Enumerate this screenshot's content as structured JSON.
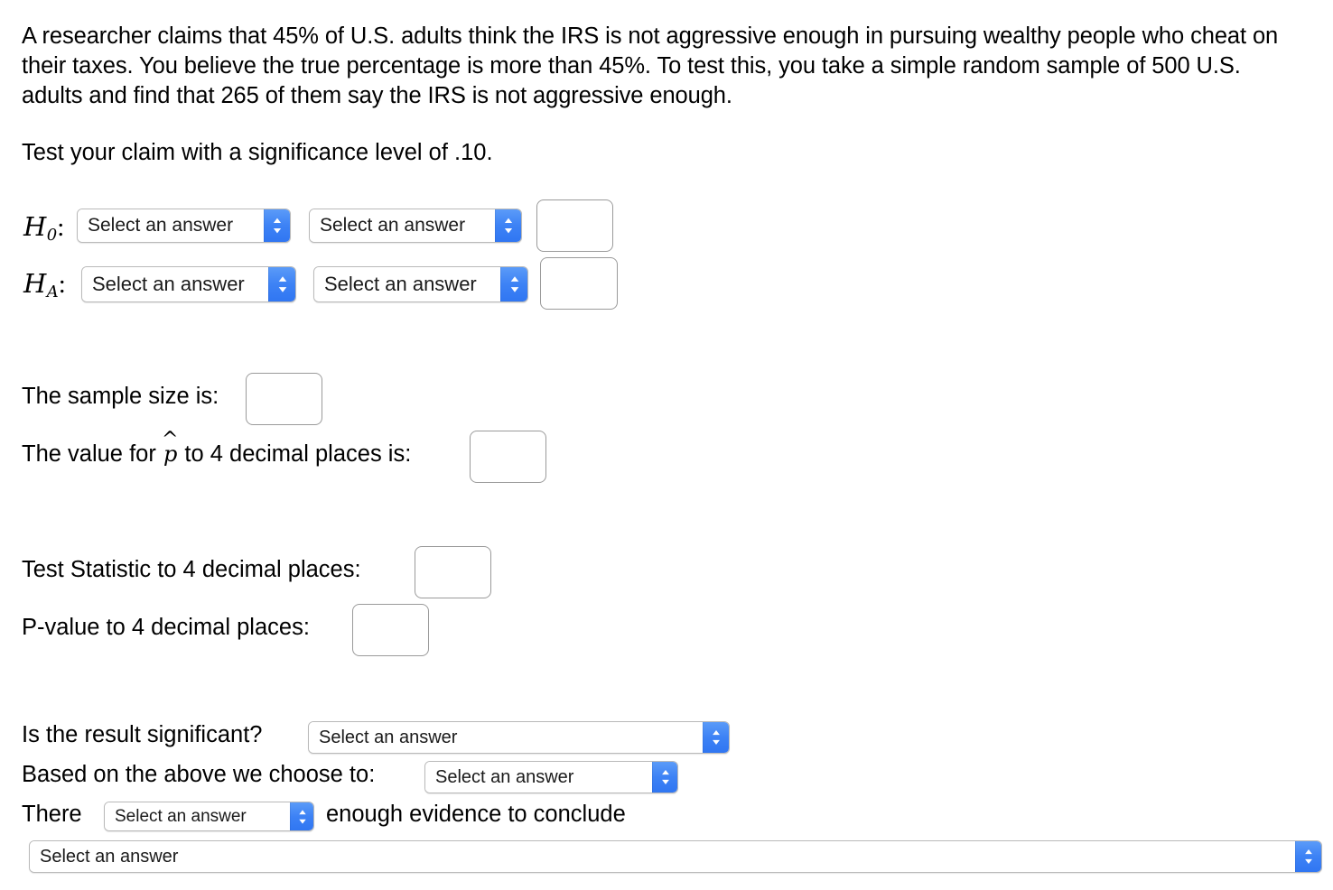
{
  "problem": {
    "statement": "A researcher claims that 45% of U.S. adults think the IRS is not aggressive enough in pursuing wealthy people who cheat on their taxes. You believe the true percentage is more than 45%. To test this, you take a simple random sample of 500 U.S. adults and find that 265 of them say the IRS is not aggressive enough.",
    "significance_instruction": "Test your claim with a significance level of .10."
  },
  "select_placeholder": "Select an answer",
  "hypotheses": {
    "null_label_base": "H",
    "null_label_sub": "0",
    "alt_label_base": "H",
    "alt_label_sub": "A",
    "colon": ":",
    "null_left_select": "Select an answer",
    "null_right_select": "Select an answer",
    "null_value": "",
    "alt_left_select": "Select an answer",
    "alt_right_select": "Select an answer",
    "alt_value": ""
  },
  "sample": {
    "sample_size_label": "The sample size is:",
    "sample_size_value": "",
    "phat_label_before": "The value for",
    "phat_symbol": "p",
    "phat_hat": "^",
    "phat_label_after": "to 4 decimal places is:",
    "phat_value": ""
  },
  "results": {
    "test_statistic_label": "Test Statistic to 4 decimal places:",
    "test_statistic_value": "",
    "pvalue_label": "P-value to 4 decimal places:",
    "pvalue_value": ""
  },
  "conclusion": {
    "significant_label": "Is the result significant?",
    "significant_select": "Select an answer",
    "choose_label": "Based on the above we choose to:",
    "choose_select": "Select an answer",
    "there_label": "There",
    "there_select": "Select an answer",
    "evidence_label": "enough evidence to conclude",
    "final_select": "Select an answer"
  },
  "colors": {
    "accent_blue": "#3d82f5",
    "input_border": "#9a9a9a",
    "select_border": "#b9b9b9",
    "text": "#000000",
    "background": "#ffffff"
  },
  "icons": {
    "stepper": "chevron-up-down-icon"
  }
}
